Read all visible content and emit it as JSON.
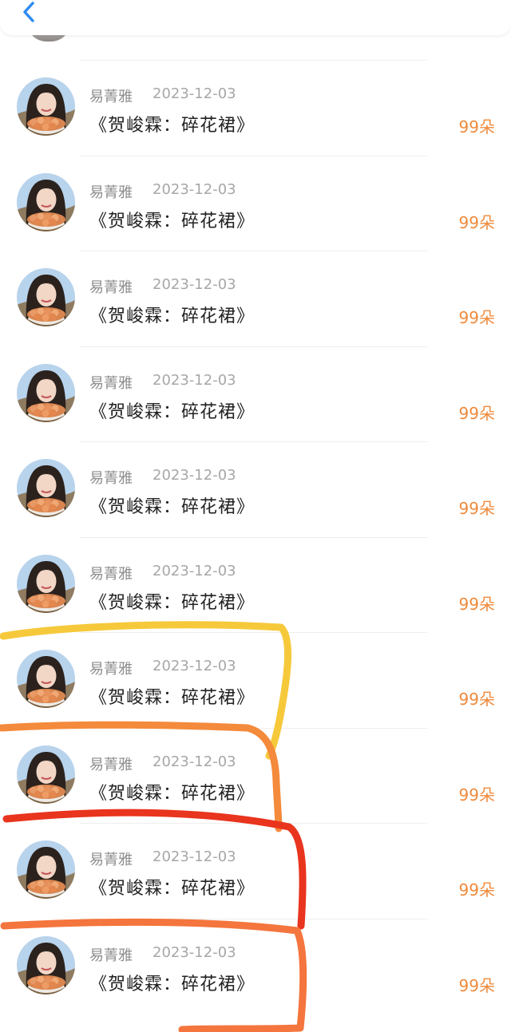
{
  "colors": {
    "amount": "#ef8a3c",
    "back_arrow": "#2f8cf0",
    "mark_yellow": "#f6c93b",
    "mark_orange": "#f48a3b",
    "mark_red": "#e9341e",
    "mark_coral": "#f4753d"
  },
  "top_bar": {
    "back_icon": "chevron-left-icon"
  },
  "list": {
    "items": [
      {
        "name": "易菁雅",
        "date": "2023-12-03",
        "title": "《贺峻霖：碎花裙》",
        "amount": "99朵"
      },
      {
        "name": "易菁雅",
        "date": "2023-12-03",
        "title": "《贺峻霖：碎花裙》",
        "amount": "99朵"
      },
      {
        "name": "易菁雅",
        "date": "2023-12-03",
        "title": "《贺峻霖：碎花裙》",
        "amount": "99朵"
      },
      {
        "name": "易菁雅",
        "date": "2023-12-03",
        "title": "《贺峻霖：碎花裙》",
        "amount": "99朵"
      },
      {
        "name": "易菁雅",
        "date": "2023-12-03",
        "title": "《贺峻霖：碎花裙》",
        "amount": "99朵"
      },
      {
        "name": "易菁雅",
        "date": "2023-12-03",
        "title": "《贺峻霖：碎花裙》",
        "amount": "99朵"
      },
      {
        "name": "易菁雅",
        "date": "2023-12-03",
        "title": "《贺峻霖：碎花裙》",
        "amount": "99朵"
      },
      {
        "name": "易菁雅",
        "date": "2023-12-03",
        "title": "《贺峻霖：碎花裙》",
        "amount": "99朵"
      },
      {
        "name": "易菁雅",
        "date": "2023-12-03",
        "title": "《贺峻霖：碎花裙》",
        "amount": "99朵"
      },
      {
        "name": "易菁雅",
        "date": "2023-12-03",
        "title": "《贺峻霖：碎花裙》",
        "amount": "99朵"
      }
    ]
  }
}
